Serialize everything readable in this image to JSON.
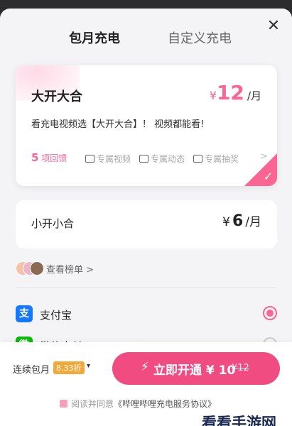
{
  "tabs": {
    "monthly": "包月充电",
    "custom": "自定义充电"
  },
  "close_icon": "close-icon",
  "main_plan": {
    "name": "大开大合",
    "currency": "¥",
    "price": "12",
    "unit": "/月",
    "description": "看充电视频选【大开大合】！ 视频都能看!",
    "benefit_count_number": "5",
    "benefit_count_suffix": "项回馈",
    "benefits": [
      {
        "label": "专属视频",
        "icon": "video-icon"
      },
      {
        "label": "专属动态",
        "icon": "message-icon"
      },
      {
        "label": "专属抽奖",
        "icon": "gift-icon"
      }
    ],
    "more_arrow": ">",
    "selected": true
  },
  "secondary_plan": {
    "name": "小开小合",
    "currency": "¥",
    "price": "6",
    "unit": "/月"
  },
  "ranking": {
    "label": "查看榜单",
    "arrow": ">"
  },
  "payment_methods": [
    {
      "label": "支付宝",
      "icon_char": "支",
      "color": "#1677ff",
      "selected": true
    },
    {
      "label": "微信支付",
      "icon_char": "微",
      "color": "#09bb07",
      "selected": false
    }
  ],
  "bottom": {
    "renew_label": "连续包月",
    "discount": "8.33折",
    "caret": "▾",
    "button_label": "立即开通 ¥ 10",
    "button_original_price": "¥12",
    "agree_prefix": "阅读并同意",
    "agreement_link": "《哔哩哔哩充电服务协议》"
  },
  "watermark": "看看手游网",
  "colors": {
    "accent": "#fb6594",
    "button": "#f04c82",
    "discount": "#f2a93b",
    "alipay": "#1677ff",
    "wechat": "#09bb07"
  }
}
